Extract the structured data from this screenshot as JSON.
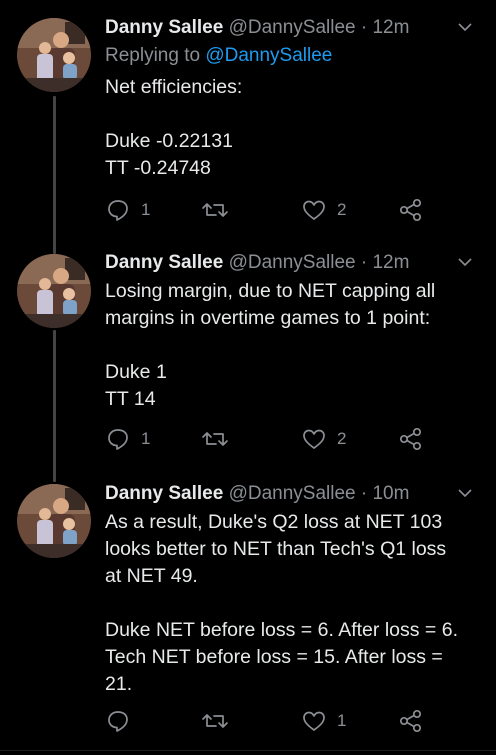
{
  "tweets": [
    {
      "name": "Danny Sallee",
      "handle": "@DannySallee",
      "dot": "·",
      "time": "12m",
      "replying_prefix": "Replying to",
      "replying_to": "@DannySallee",
      "lines": [
        "Net efficiencies:",
        "",
        "Duke -0.22131",
        "TT -0.24748"
      ],
      "reply_count": "1",
      "retweet_count": "",
      "like_count": "2"
    },
    {
      "name": "Danny Sallee",
      "handle": "@DannySallee",
      "dot": "·",
      "time": "12m",
      "lines": [
        "Losing margin, due to NET capping all",
        "margins in overtime games to 1 point:",
        "",
        "Duke 1",
        "TT 14"
      ],
      "reply_count": "1",
      "retweet_count": "",
      "like_count": "2"
    },
    {
      "name": "Danny Sallee",
      "handle": "@DannySallee",
      "dot": "·",
      "time": "10m",
      "lines": [
        "As a result, Duke's Q2 loss at NET 103",
        "looks better to NET than Tech's Q1 loss",
        "at NET 49.",
        "",
        "Duke NET before loss = 6. After loss = 6.",
        "Tech NET before loss = 15. After loss =",
        "21."
      ],
      "reply_count": "",
      "retweet_count": "",
      "like_count": "1"
    }
  ],
  "icons": {
    "reply": "reply-icon",
    "retweet": "retweet-icon",
    "like": "heart-icon",
    "share": "share-icon",
    "menu": "chevron-down-icon"
  },
  "colors": {
    "background": "#000000",
    "text": "#e7e9ea",
    "muted": "#8b8f94",
    "link": "#1d9bf0",
    "thread_line": "#444444"
  }
}
